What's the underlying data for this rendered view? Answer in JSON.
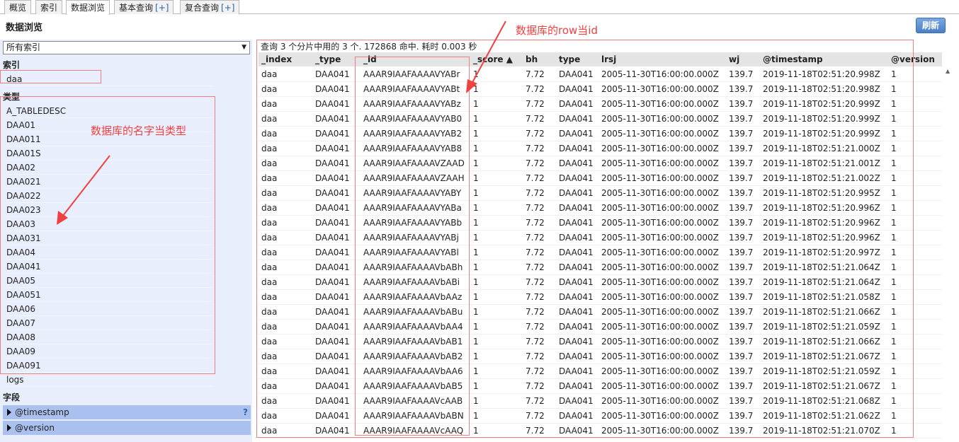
{
  "tabs": [
    {
      "label": "概览",
      "plus": ""
    },
    {
      "label": "索引",
      "plus": ""
    },
    {
      "label": "数据浏览",
      "plus": ""
    },
    {
      "label": "基本查询",
      "plus": "[+]"
    },
    {
      "label": "复合查询",
      "plus": "[+]"
    }
  ],
  "header": {
    "title": "数据浏览",
    "refresh": "刷新"
  },
  "sidebar": {
    "select_value": "所有索引",
    "index_label": "索引",
    "indices": [
      "daa"
    ],
    "type_label": "类型",
    "types": [
      "A_TABLEDESC",
      "DAA01",
      "DAA011",
      "DAA01S",
      "DAA02",
      "DAA021",
      "DAA022",
      "DAA023",
      "DAA03",
      "DAA031",
      "DAA04",
      "DAA041",
      "DAA05",
      "DAA051",
      "DAA06",
      "DAA07",
      "DAA08",
      "DAA09",
      "DAA091",
      "logs"
    ],
    "field_label": "字段",
    "fields": [
      "@timestamp",
      "@version"
    ],
    "help": "?"
  },
  "main": {
    "summary": "查询 3 个分片中用的 3 个. 172868 命中. 耗时 0.003 秒",
    "columns": [
      "_index",
      "_type",
      "_id",
      "_score ▲",
      "bh",
      "type",
      "lrsj",
      "wj",
      "@timestamp",
      "@version"
    ],
    "rows": [
      [
        "daa",
        "DAA041",
        "AAAR9IAAFAAAAVYABr",
        "1",
        "7.72",
        "DAA041",
        "2005-11-30T16:00:00.000Z",
        "139.7",
        "2019-11-18T02:51:20.998Z",
        "1"
      ],
      [
        "daa",
        "DAA041",
        "AAAR9IAAFAAAAVYABt",
        "1",
        "7.72",
        "DAA041",
        "2005-11-30T16:00:00.000Z",
        "139.7",
        "2019-11-18T02:51:20.998Z",
        "1"
      ],
      [
        "daa",
        "DAA041",
        "AAAR9IAAFAAAAVYABz",
        "1",
        "7.72",
        "DAA041",
        "2005-11-30T16:00:00.000Z",
        "139.7",
        "2019-11-18T02:51:20.999Z",
        "1"
      ],
      [
        "daa",
        "DAA041",
        "AAAR9IAAFAAAAVYAB0",
        "1",
        "7.72",
        "DAA041",
        "2005-11-30T16:00:00.000Z",
        "139.7",
        "2019-11-18T02:51:20.999Z",
        "1"
      ],
      [
        "daa",
        "DAA041",
        "AAAR9IAAFAAAAVYAB2",
        "1",
        "7.72",
        "DAA041",
        "2005-11-30T16:00:00.000Z",
        "139.7",
        "2019-11-18T02:51:20.999Z",
        "1"
      ],
      [
        "daa",
        "DAA041",
        "AAAR9IAAFAAAAVYAB8",
        "1",
        "7.72",
        "DAA041",
        "2005-11-30T16:00:00.000Z",
        "139.7",
        "2019-11-18T02:51:21.000Z",
        "1"
      ],
      [
        "daa",
        "DAA041",
        "AAAR9IAAFAAAAVZAAD",
        "1",
        "7.72",
        "DAA041",
        "2005-11-30T16:00:00.000Z",
        "139.7",
        "2019-11-18T02:51:21.001Z",
        "1"
      ],
      [
        "daa",
        "DAA041",
        "AAAR9IAAFAAAAVZAAH",
        "1",
        "7.72",
        "DAA041",
        "2005-11-30T16:00:00.000Z",
        "139.7",
        "2019-11-18T02:51:21.002Z",
        "1"
      ],
      [
        "daa",
        "DAA041",
        "AAAR9IAAFAAAAVYABY",
        "1",
        "7.72",
        "DAA041",
        "2005-11-30T16:00:00.000Z",
        "139.7",
        "2019-11-18T02:51:20.995Z",
        "1"
      ],
      [
        "daa",
        "DAA041",
        "AAAR9IAAFAAAAVYABa",
        "1",
        "7.72",
        "DAA041",
        "2005-11-30T16:00:00.000Z",
        "139.7",
        "2019-11-18T02:51:20.996Z",
        "1"
      ],
      [
        "daa",
        "DAA041",
        "AAAR9IAAFAAAAVYABb",
        "1",
        "7.72",
        "DAA041",
        "2005-11-30T16:00:00.000Z",
        "139.7",
        "2019-11-18T02:51:20.996Z",
        "1"
      ],
      [
        "daa",
        "DAA041",
        "AAAR9IAAFAAAAVYABj",
        "1",
        "7.72",
        "DAA041",
        "2005-11-30T16:00:00.000Z",
        "139.7",
        "2019-11-18T02:51:20.996Z",
        "1"
      ],
      [
        "daa",
        "DAA041",
        "AAAR9IAAFAAAAVYABl",
        "1",
        "7.72",
        "DAA041",
        "2005-11-30T16:00:00.000Z",
        "139.7",
        "2019-11-18T02:51:20.997Z",
        "1"
      ],
      [
        "daa",
        "DAA041",
        "AAAR9IAAFAAAAVbABh",
        "1",
        "7.72",
        "DAA041",
        "2005-11-30T16:00:00.000Z",
        "139.7",
        "2019-11-18T02:51:21.064Z",
        "1"
      ],
      [
        "daa",
        "DAA041",
        "AAAR9IAAFAAAAVbABi",
        "1",
        "7.72",
        "DAA041",
        "2005-11-30T16:00:00.000Z",
        "139.7",
        "2019-11-18T02:51:21.064Z",
        "1"
      ],
      [
        "daa",
        "DAA041",
        "AAAR9IAAFAAAAVbAAz",
        "1",
        "7.72",
        "DAA041",
        "2005-11-30T16:00:00.000Z",
        "139.7",
        "2019-11-18T02:51:21.058Z",
        "1"
      ],
      [
        "daa",
        "DAA041",
        "AAAR9IAAFAAAAVbABu",
        "1",
        "7.72",
        "DAA041",
        "2005-11-30T16:00:00.000Z",
        "139.7",
        "2019-11-18T02:51:21.066Z",
        "1"
      ],
      [
        "daa",
        "DAA041",
        "AAAR9IAAFAAAAVbAA4",
        "1",
        "7.72",
        "DAA041",
        "2005-11-30T16:00:00.000Z",
        "139.7",
        "2019-11-18T02:51:21.059Z",
        "1"
      ],
      [
        "daa",
        "DAA041",
        "AAAR9IAAFAAAAVbAB1",
        "1",
        "7.72",
        "DAA041",
        "2005-11-30T16:00:00.000Z",
        "139.7",
        "2019-11-18T02:51:21.066Z",
        "1"
      ],
      [
        "daa",
        "DAA041",
        "AAAR9IAAFAAAAVbAB2",
        "1",
        "7.72",
        "DAA041",
        "2005-11-30T16:00:00.000Z",
        "139.7",
        "2019-11-18T02:51:21.067Z",
        "1"
      ],
      [
        "daa",
        "DAA041",
        "AAAR9IAAFAAAAVbAA6",
        "1",
        "7.72",
        "DAA041",
        "2005-11-30T16:00:00.000Z",
        "139.7",
        "2019-11-18T02:51:21.059Z",
        "1"
      ],
      [
        "daa",
        "DAA041",
        "AAAR9IAAFAAAAVbAB5",
        "1",
        "7.72",
        "DAA041",
        "2005-11-30T16:00:00.000Z",
        "139.7",
        "2019-11-18T02:51:21.067Z",
        "1"
      ],
      [
        "daa",
        "DAA041",
        "AAAR9IAAFAAAAVcAAB",
        "1",
        "7.72",
        "DAA041",
        "2005-11-30T16:00:00.000Z",
        "139.7",
        "2019-11-18T02:51:21.068Z",
        "1"
      ],
      [
        "daa",
        "DAA041",
        "AAAR9IAAFAAAAVbABN",
        "1",
        "7.72",
        "DAA041",
        "2005-11-30T16:00:00.000Z",
        "139.7",
        "2019-11-18T02:51:21.062Z",
        "1"
      ],
      [
        "daa",
        "DAA041",
        "AAAR9IAAFAAAAVcAAQ",
        "1",
        "7.72",
        "DAA041",
        "2005-11-30T16:00:00.000Z",
        "139.7",
        "2019-11-18T02:51:21.070Z",
        "1"
      ]
    ]
  },
  "annotations": {
    "type_note": "数据库的名字当类型",
    "id_note": "数据库的row当id",
    "color": "#f04040"
  }
}
